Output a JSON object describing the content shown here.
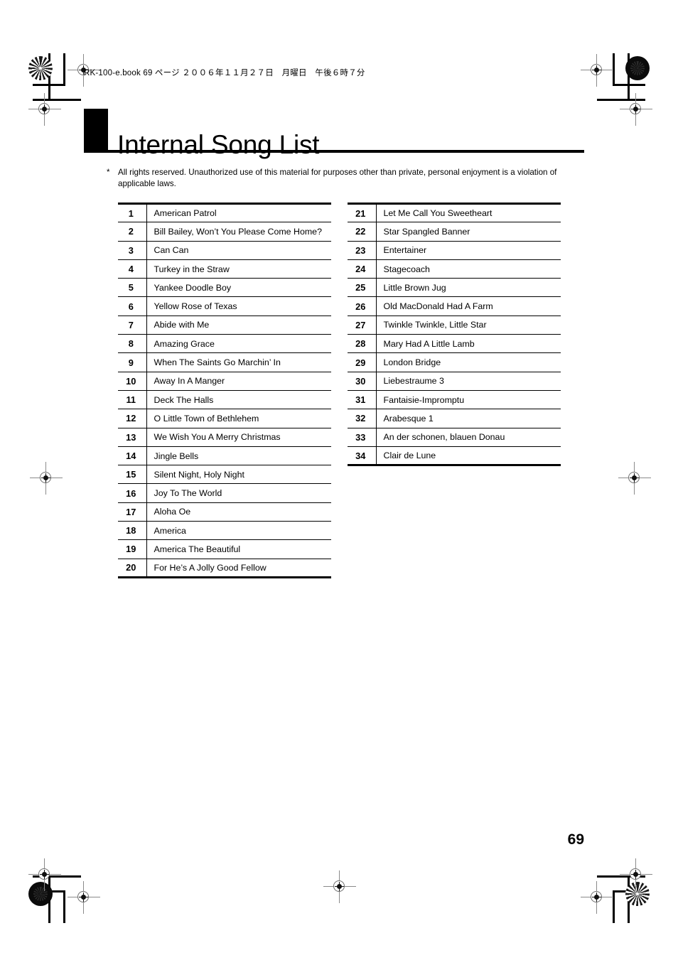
{
  "header": {
    "file_info": "RK-100-e.book 69 ページ ２００６年１１月２７日　月曜日　午後６時７分"
  },
  "title": {
    "text": "Internal Song List"
  },
  "footnote": {
    "marker": "*",
    "text": "All rights reserved. Unauthorized use of this material for purposes other than private, personal enjoyment is a violation of applicable laws."
  },
  "song_list": {
    "left_column": [
      {
        "number": "1",
        "name": "American Patrol"
      },
      {
        "number": "2",
        "name": "Bill Bailey, Won’t You Please Come Home?"
      },
      {
        "number": "3",
        "name": "Can Can"
      },
      {
        "number": "4",
        "name": "Turkey in the Straw"
      },
      {
        "number": "5",
        "name": "Yankee Doodle Boy"
      },
      {
        "number": "6",
        "name": "Yellow Rose of Texas"
      },
      {
        "number": "7",
        "name": "Abide with Me"
      },
      {
        "number": "8",
        "name": "Amazing Grace"
      },
      {
        "number": "9",
        "name": "When The Saints Go Marchin’ In"
      },
      {
        "number": "10",
        "name": "Away In A Manger"
      },
      {
        "number": "11",
        "name": "Deck The Halls"
      },
      {
        "number": "12",
        "name": "O Little Town of Bethlehem"
      },
      {
        "number": "13",
        "name": "We Wish You A Merry Christmas"
      },
      {
        "number": "14",
        "name": "Jingle Bells"
      },
      {
        "number": "15",
        "name": "Silent Night, Holy Night"
      },
      {
        "number": "16",
        "name": "Joy To The World"
      },
      {
        "number": "17",
        "name": "Aloha Oe"
      },
      {
        "number": "18",
        "name": "America"
      },
      {
        "number": "19",
        "name": "America The Beautiful"
      },
      {
        "number": "20",
        "name": "For He’s A Jolly Good Fellow"
      }
    ],
    "right_column": [
      {
        "number": "21",
        "name": "Let Me Call You Sweetheart"
      },
      {
        "number": "22",
        "name": "Star Spangled Banner"
      },
      {
        "number": "23",
        "name": "Entertainer"
      },
      {
        "number": "24",
        "name": "Stagecoach"
      },
      {
        "number": "25",
        "name": "Little Brown Jug"
      },
      {
        "number": "26",
        "name": "Old MacDonald Had A Farm"
      },
      {
        "number": "27",
        "name": "Twinkle Twinkle, Little Star"
      },
      {
        "number": "28",
        "name": "Mary Had A Little Lamb"
      },
      {
        "number": "29",
        "name": "London Bridge"
      },
      {
        "number": "30",
        "name": "Liebestraume 3"
      },
      {
        "number": "31",
        "name": "Fantaisie-Impromptu"
      },
      {
        "number": "32",
        "name": "Arabesque 1"
      },
      {
        "number": "33",
        "name": "An der schonen, blauen Donau"
      },
      {
        "number": "34",
        "name": "Clair de Lune"
      }
    ]
  },
  "footer": {
    "page_number": "69"
  },
  "colors": {
    "ink": "#000000",
    "paper": "#ffffff",
    "registration_mark": "#8a8a8a"
  }
}
